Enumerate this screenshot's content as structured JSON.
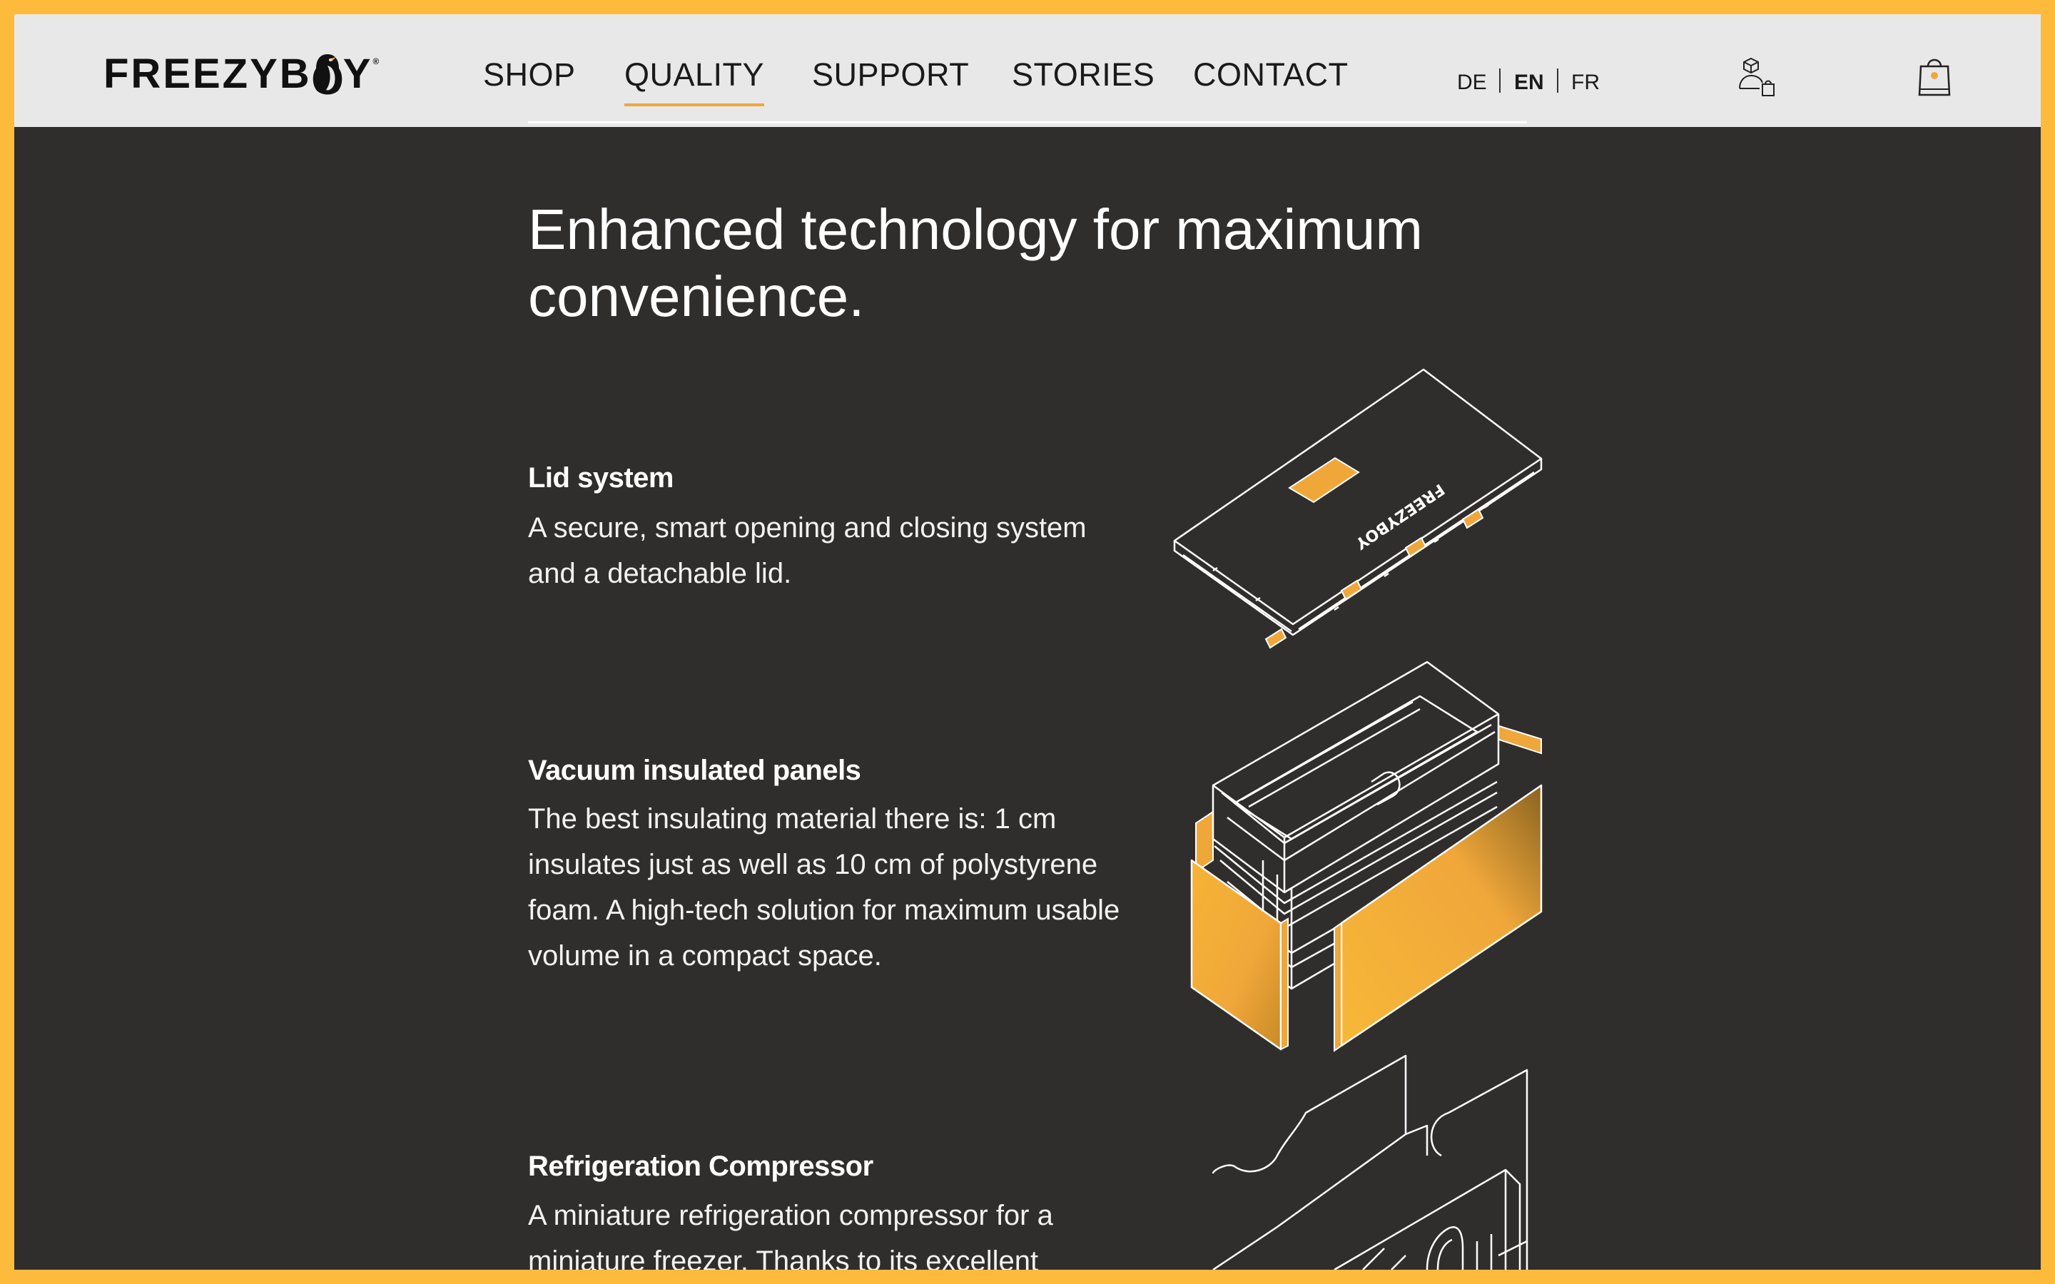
{
  "brand": {
    "name_left": "FREEZYB",
    "name_right": "Y",
    "registered": "®",
    "accent": "#f0a73a"
  },
  "nav": {
    "items": [
      {
        "label": "SHOP"
      },
      {
        "label": "QUALITY",
        "active": true
      },
      {
        "label": "SUPPORT"
      },
      {
        "label": "STORIES"
      },
      {
        "label": "CONTACT"
      }
    ]
  },
  "languages": {
    "items": [
      "DE",
      "EN",
      "FR"
    ],
    "selected": "EN"
  },
  "header_icons": [
    "account-icon",
    "cart-icon"
  ],
  "main": {
    "heading": "Enhanced technology for maximum convenience.",
    "features": [
      {
        "title": "Lid system",
        "body": "A secure, smart opening and closing system and a detachable lid."
      },
      {
        "title": "Vacuum insulated panels",
        "body": "The best insulating material there is: 1 cm insulates just as well as 10 cm of polystyrene foam. A high-tech solution for maximum usable volume in a compact space."
      },
      {
        "title": "Refrigeration Compressor",
        "body": "A miniature refrigeration compressor for a miniature freezer. Thanks to its excellent"
      }
    ],
    "illustrations": [
      "lid-illustration",
      "insulated-panels-illustration",
      "compressor-illustration"
    ],
    "lid_print": "FREEZYBOY"
  },
  "colors": {
    "background": "#302e2d",
    "header": "#e8e8e8",
    "frame": "#fdba3b",
    "accent": "#f0a73a"
  }
}
